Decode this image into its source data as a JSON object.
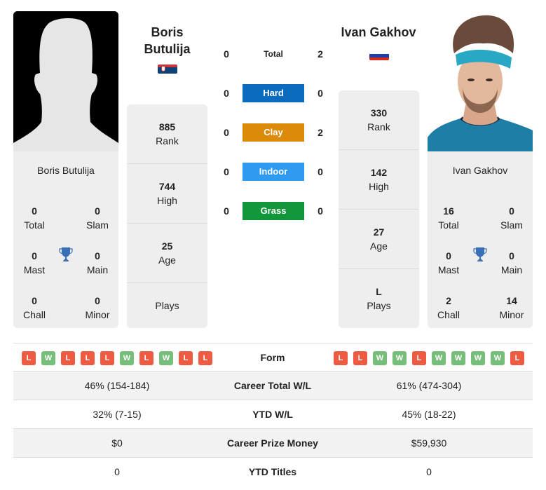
{
  "player1": {
    "name": "Boris Butulija",
    "name_line1": "Boris",
    "name_line2": "Butulija",
    "country": "Serbia",
    "flag_colors": [
      "#c6363c",
      "#0c4076",
      "#ffffff"
    ],
    "photo": "silhouette-placeholder",
    "titles": {
      "total": {
        "value": "0",
        "label": "Total"
      },
      "slam": {
        "value": "0",
        "label": "Slam"
      },
      "mast": {
        "value": "0",
        "label": "Mast"
      },
      "main": {
        "value": "0",
        "label": "Main"
      },
      "chall": {
        "value": "0",
        "label": "Chall"
      },
      "minor": {
        "value": "0",
        "label": "Minor"
      }
    },
    "stats": {
      "rank": {
        "value": "885",
        "label": "Rank"
      },
      "high": {
        "value": "744",
        "label": "High"
      },
      "age": {
        "value": "25",
        "label": "Age"
      },
      "plays": {
        "value": "",
        "label": "Plays"
      }
    },
    "form": [
      "L",
      "W",
      "L",
      "L",
      "L",
      "W",
      "L",
      "W",
      "L",
      "L"
    ]
  },
  "player2": {
    "name": "Ivan Gakhov",
    "country": "Russia",
    "flag_colors": [
      "#ffffff",
      "#1c3fa8",
      "#d52b1e"
    ],
    "photo": "player-photo",
    "titles": {
      "total": {
        "value": "16",
        "label": "Total"
      },
      "slam": {
        "value": "0",
        "label": "Slam"
      },
      "mast": {
        "value": "0",
        "label": "Mast"
      },
      "main": {
        "value": "0",
        "label": "Main"
      },
      "chall": {
        "value": "2",
        "label": "Chall"
      },
      "minor": {
        "value": "14",
        "label": "Minor"
      }
    },
    "stats": {
      "rank": {
        "value": "330",
        "label": "Rank"
      },
      "high": {
        "value": "142",
        "label": "High"
      },
      "age": {
        "value": "27",
        "label": "Age"
      },
      "plays": {
        "value": "L",
        "label": "Plays"
      }
    },
    "form": [
      "L",
      "L",
      "W",
      "W",
      "L",
      "W",
      "W",
      "W",
      "W",
      "L"
    ]
  },
  "h2h": [
    {
      "label": "Total",
      "p1": "0",
      "p2": "2",
      "color": ""
    },
    {
      "label": "Hard",
      "p1": "0",
      "p2": "0",
      "color": "#0a6bbf"
    },
    {
      "label": "Clay",
      "p1": "0",
      "p2": "2",
      "color": "#dc8a0a"
    },
    {
      "label": "Indoor",
      "p1": "0",
      "p2": "0",
      "color": "#2e9bf0"
    },
    {
      "label": "Grass",
      "p1": "0",
      "p2": "0",
      "color": "#119739"
    }
  ],
  "colors": {
    "win": "#76be79",
    "loss": "#ec5b42",
    "trophy": "#3a70b8",
    "card_bg": "#eeeeee"
  },
  "form_label": "Form",
  "comparison": [
    {
      "label": "Career Total W/L",
      "p1": "46% (154-184)",
      "p2": "61% (474-304)"
    },
    {
      "label": "YTD W/L",
      "p1": "32% (7-15)",
      "p2": "45% (18-22)"
    },
    {
      "label": "Career Prize Money",
      "p1": "$0",
      "p2": "$59,930"
    },
    {
      "label": "YTD Titles",
      "p1": "0",
      "p2": "0"
    }
  ]
}
